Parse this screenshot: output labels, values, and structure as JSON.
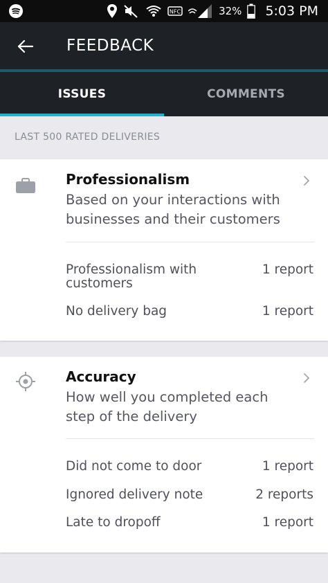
{
  "status_bar": {
    "battery_pct": "32%",
    "time": "5:03 PM"
  },
  "app_bar": {
    "title": "FEEDBACK",
    "back_icon": "arrow-left-icon"
  },
  "tabs": [
    {
      "label": "ISSUES",
      "active": true
    },
    {
      "label": "COMMENTS",
      "active": false
    }
  ],
  "section_header": "LAST 500 RATED DELIVERIES",
  "categories": [
    {
      "icon": "briefcase-icon",
      "title": "Professionalism",
      "description": "Based on your interactions with businesses and their customers",
      "issues": [
        {
          "label": "Professionalism with customers",
          "count": "1 report"
        },
        {
          "label": "No delivery bag",
          "count": "1 report"
        }
      ]
    },
    {
      "icon": "crosshair-icon",
      "title": "Accuracy",
      "description": "How well you completed each step of the delivery",
      "issues": [
        {
          "label": "Did not come to door",
          "count": "1 report"
        },
        {
          "label": "Ignored delivery note",
          "count": "2 reports"
        },
        {
          "label": "Late to dropoff",
          "count": "1 report"
        }
      ]
    }
  ],
  "colors": {
    "app_bar_bg": "#1e2126",
    "tab_indicator": "#20b3d0",
    "page_bg": "#e9e9ee"
  }
}
